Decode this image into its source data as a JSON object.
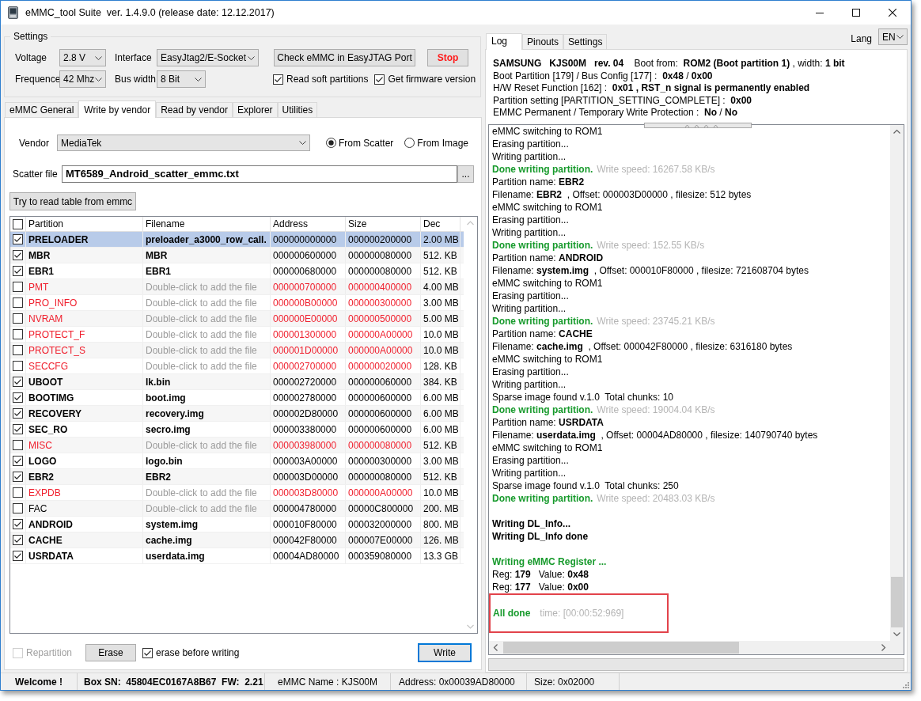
{
  "window": {
    "title": "eMMC_tool Suite  ver. 1.4.9.0 (release date: 12.12.2017)"
  },
  "settings": {
    "title": "Settings",
    "voltage": {
      "label": "Voltage",
      "value": "2.8 V"
    },
    "interface": {
      "label": "Interface",
      "value": "EasyJtag2/E-Socket"
    },
    "frequence": {
      "label": "Frequence",
      "value": "42 Mhz"
    },
    "bus_width": {
      "label": "Bus width",
      "value": "8 Bit"
    },
    "check_button": "Check eMMC in EasyJTAG Port",
    "stop_button": "Stop",
    "options": [
      {
        "label": "Read soft partitions",
        "checked": true
      },
      {
        "label": "Get firmware version",
        "checked": true
      }
    ]
  },
  "tabs": [
    {
      "label": "eMMC General",
      "selected": false
    },
    {
      "label": "Write by vendor",
      "selected": true
    },
    {
      "label": "Read by vendor",
      "selected": false
    },
    {
      "label": "Explorer",
      "selected": false
    },
    {
      "label": "Utilities",
      "selected": false
    }
  ],
  "vendor": {
    "label": "Vendor",
    "value": "MediaTek"
  },
  "source": [
    {
      "label": "From Scatter",
      "selected": true
    },
    {
      "label": "From Image",
      "selected": false
    }
  ],
  "scatter_file": {
    "label": "Scatter file",
    "value": "MT6589_Android_scatter_emmc.txt",
    "browse_button": "..."
  },
  "read_table_button": "Try to read table from emmc",
  "table": {
    "all_checked": false,
    "columns": [
      "Partition",
      "Filename",
      "Address",
      "Size",
      "Dec"
    ],
    "rows": [
      {
        "checked": true,
        "selected": true,
        "kind": "loaded",
        "cells": [
          "PRELOADER",
          "preloader_a3000_row_call.",
          "000000000000",
          "000000200000",
          "2.00 MB"
        ]
      },
      {
        "checked": true,
        "selected": false,
        "kind": "loaded",
        "cells": [
          "MBR",
          "MBR",
          "000000600000",
          "000000080000",
          "512. KB"
        ]
      },
      {
        "checked": true,
        "selected": false,
        "kind": "loaded",
        "cells": [
          "EBR1",
          "EBR1",
          "000000680000",
          "000000080000",
          "512. KB"
        ]
      },
      {
        "checked": false,
        "selected": false,
        "kind": "missing",
        "cells": [
          "PMT",
          "Double-click to add the file",
          "000000700000",
          "000000400000",
          "4.00 MB"
        ]
      },
      {
        "checked": false,
        "selected": false,
        "kind": "missing",
        "cells": [
          "PRO_INFO",
          "Double-click to add the file",
          "000000B00000",
          "000000300000",
          "3.00 MB"
        ]
      },
      {
        "checked": false,
        "selected": false,
        "kind": "missing",
        "cells": [
          "NVRAM",
          "Double-click to add the file",
          "000000E00000",
          "000000500000",
          "5.00 MB"
        ]
      },
      {
        "checked": false,
        "selected": false,
        "kind": "missing",
        "cells": [
          "PROTECT_F",
          "Double-click to add the file",
          "000001300000",
          "000000A00000",
          "10.0 MB"
        ]
      },
      {
        "checked": false,
        "selected": false,
        "kind": "missing",
        "cells": [
          "PROTECT_S",
          "Double-click to add the file",
          "000001D00000",
          "000000A00000",
          "10.0 MB"
        ]
      },
      {
        "checked": false,
        "selected": false,
        "kind": "missing",
        "cells": [
          "SECCFG",
          "Double-click to add the file",
          "000002700000",
          "000000020000",
          "128. KB"
        ]
      },
      {
        "checked": true,
        "selected": false,
        "kind": "loaded",
        "cells": [
          "UBOOT",
          "lk.bin",
          "000002720000",
          "000000060000",
          "384. KB"
        ]
      },
      {
        "checked": true,
        "selected": false,
        "kind": "loaded",
        "cells": [
          "BOOTIMG",
          "boot.img",
          "000002780000",
          "000000600000",
          "6.00 MB"
        ]
      },
      {
        "checked": true,
        "selected": false,
        "kind": "loaded",
        "cells": [
          "RECOVERY",
          "recovery.img",
          "000002D80000",
          "000000600000",
          "6.00 MB"
        ]
      },
      {
        "checked": true,
        "selected": false,
        "kind": "loaded",
        "cells": [
          "SEC_RO",
          "secro.img",
          "000003380000",
          "000000600000",
          "6.00 MB"
        ]
      },
      {
        "checked": false,
        "selected": false,
        "kind": "missing",
        "cells": [
          "MISC",
          "Double-click to add the file",
          "000003980000",
          "000000080000",
          "512. KB"
        ]
      },
      {
        "checked": true,
        "selected": false,
        "kind": "loaded",
        "cells": [
          "LOGO",
          "logo.bin",
          "000003A00000",
          "000000300000",
          "3.00 MB"
        ]
      },
      {
        "checked": true,
        "selected": false,
        "kind": "loaded",
        "cells": [
          "EBR2",
          "EBR2",
          "000003D00000",
          "000000080000",
          "512. KB"
        ]
      },
      {
        "checked": false,
        "selected": false,
        "kind": "missing",
        "cells": [
          "EXPDB",
          "Double-click to add the file",
          "000003D80000",
          "000000A00000",
          "10.0 MB"
        ]
      },
      {
        "checked": false,
        "selected": false,
        "kind": "empty",
        "cells": [
          "FAC",
          "Double-click to add the file",
          "000004780000",
          "00000C800000",
          "200. MB"
        ]
      },
      {
        "checked": true,
        "selected": false,
        "kind": "loaded",
        "cells": [
          "ANDROID",
          "system.img",
          "000010F80000",
          "000032000000",
          "800. MB"
        ]
      },
      {
        "checked": true,
        "selected": false,
        "kind": "loaded",
        "cells": [
          "CACHE",
          "cache.img",
          "000042F80000",
          "000007E00000",
          "126. MB"
        ]
      },
      {
        "checked": true,
        "selected": false,
        "kind": "loaded",
        "cells": [
          "USRDATA",
          "userdata.img",
          "00004AD80000",
          "000359080000",
          "13.3 GB"
        ]
      }
    ]
  },
  "bottom": {
    "repartition": {
      "label": "Repartition",
      "checked": false,
      "disabled": true
    },
    "erase_button": "Erase",
    "erase_before": {
      "label": "erase before writing",
      "checked": true
    },
    "write_button": "Write"
  },
  "log_panel": {
    "tabs": [
      {
        "label": "Log",
        "selected": true
      },
      {
        "label": "Pinouts",
        "selected": false
      },
      {
        "label": "Settings",
        "selected": false
      }
    ],
    "lang_label": "Lang",
    "lang_value": "EN",
    "info": [
      "**SAMSUNG   KJS00M   rev. 04**    Boot from:  **ROM2 (Boot partition 1)** , width: **1 bit**",
      "Boot Partition [179] / Bus Config [177] :  **0x48** / **0x00**",
      "H/W Reset Function [162] :  **0x01 , RST_n signal is permanently enabled**",
      "Partition setting [PARTITION_SETTING_COMPLETE] :  **0x00**",
      "EMMC Permanent / Temporary Write Protection :  **No** / **No**"
    ],
    "log": [
      {
        "kind": "text",
        "text": "eMMC switching to ROM1"
      },
      {
        "kind": "text",
        "text": "Erasing partition..."
      },
      {
        "kind": "text",
        "text": "Writing partition..."
      },
      {
        "kind": "done",
        "text": "Done writing partition.",
        "detail": "Write speed: 16267.58 KB/s"
      },
      {
        "kind": "text",
        "text": "Partition name: **EBR2**"
      },
      {
        "kind": "text",
        "text": "Filename: **EBR2**  , Offset: 000003D00000 , filesize: 512 bytes"
      },
      {
        "kind": "text",
        "text": "eMMC switching to ROM1"
      },
      {
        "kind": "text",
        "text": "Erasing partition..."
      },
      {
        "kind": "text",
        "text": "Writing partition..."
      },
      {
        "kind": "done",
        "text": "Done writing partition.",
        "detail": "Write speed: 152.55 KB/s"
      },
      {
        "kind": "text",
        "text": "Partition name: **ANDROID**"
      },
      {
        "kind": "text",
        "text": "Filename: **system.img**  , Offset: 000010F80000 , filesize: 721608704 bytes"
      },
      {
        "kind": "text",
        "text": "eMMC switching to ROM1"
      },
      {
        "kind": "text",
        "text": "Erasing partition..."
      },
      {
        "kind": "text",
        "text": "Writing partition..."
      },
      {
        "kind": "done",
        "text": "Done writing partition.",
        "detail": "Write speed: 23745.21 KB/s"
      },
      {
        "kind": "text",
        "text": "Partition name: **CACHE**"
      },
      {
        "kind": "text",
        "text": "Filename: **cache.img**  , Offset: 000042F80000 , filesize: 6316180 bytes"
      },
      {
        "kind": "text",
        "text": "eMMC switching to ROM1"
      },
      {
        "kind": "text",
        "text": "Erasing partition..."
      },
      {
        "kind": "text",
        "text": "Writing partition..."
      },
      {
        "kind": "text",
        "text": "Sparse image found v.1.0  Total chunks: 10"
      },
      {
        "kind": "done",
        "text": "Done writing partition.",
        "detail": "Write speed: 19004.04 KB/s"
      },
      {
        "kind": "text",
        "text": "Partition name: **USRDATA**"
      },
      {
        "kind": "text",
        "text": "Filename: **userdata.img**  , Offset: 00004AD80000 , filesize: 140790740 bytes"
      },
      {
        "kind": "text",
        "text": "eMMC switching to ROM1"
      },
      {
        "kind": "text",
        "text": "Erasing partition..."
      },
      {
        "kind": "text",
        "text": "Writing partition..."
      },
      {
        "kind": "text",
        "text": "Sparse image found v.1.0  Total chunks: 250"
      },
      {
        "kind": "done",
        "text": "Done writing partition.",
        "detail": "Write speed: 20483.03 KB/s"
      },
      {
        "kind": "gap"
      },
      {
        "kind": "bold",
        "text": "Writing DL_Info..."
      },
      {
        "kind": "bold",
        "text": "Writing DL_Info done"
      },
      {
        "kind": "gap"
      },
      {
        "kind": "success",
        "text": "Writing eMMC Register ..."
      },
      {
        "kind": "text",
        "text": "Reg: **179**   Value: **0x48**"
      },
      {
        "kind": "text",
        "text": "Reg: **177**   Value: **0x00**"
      }
    ],
    "result": {
      "text": "All done",
      "detail": "time: [00:00:52:969]",
      "highlighted": true
    },
    "progress": {
      "level": 0
    }
  },
  "status_bar": [
    {
      "text": "Welcome !",
      "bold": true
    },
    {
      "text": "Box SN:  45804EC0167A8B67  FW:  2.21",
      "bold": true
    },
    {
      "text": "eMMC Name : KJS00M",
      "bold": false
    },
    {
      "text": "Address: 0x00039AD80000",
      "bold": false
    },
    {
      "text": "Size: 0x02000",
      "bold": false
    }
  ]
}
